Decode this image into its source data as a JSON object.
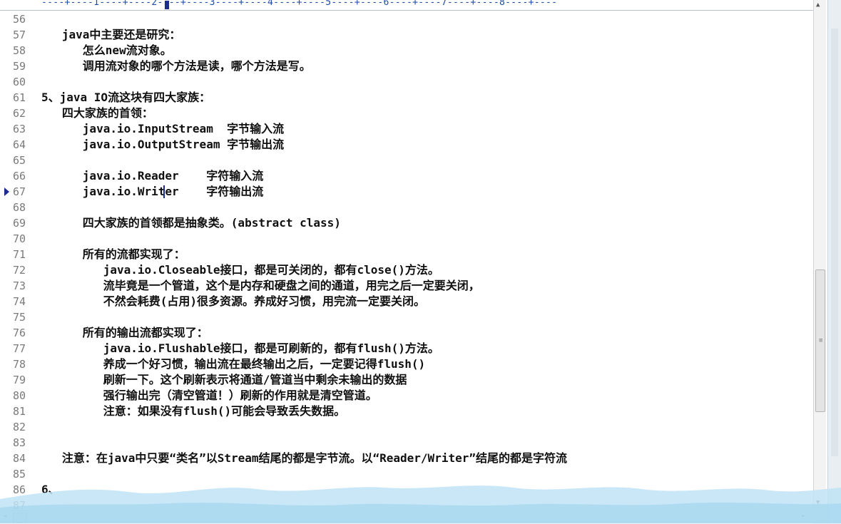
{
  "ruler": {
    "text": "----+----1----+----2----+----3----+----4----+----5----+----6----+----7----+----8----+----"
  },
  "lines": [
    {
      "num": "56",
      "text": ""
    },
    {
      "num": "57",
      "text": "   java中主要还是研究："
    },
    {
      "num": "58",
      "text": "      怎么new流对象。"
    },
    {
      "num": "59",
      "text": "      调用流对象的哪个方法是读，哪个方法是写。"
    },
    {
      "num": "60",
      "text": ""
    },
    {
      "num": "61",
      "text": "5、java IO流这块有四大家族："
    },
    {
      "num": "62",
      "text": "   四大家族的首领："
    },
    {
      "num": "63",
      "text": "      java.io.InputStream  字节输入流"
    },
    {
      "num": "64",
      "text": "      java.io.OutputStream 字节输出流"
    },
    {
      "num": "65",
      "text": ""
    },
    {
      "num": "66",
      "text": "      java.io.Reader    字符输入流"
    },
    {
      "num": "67",
      "text": "      java.io.Writer    字符输出流"
    },
    {
      "num": "68",
      "text": ""
    },
    {
      "num": "69",
      "text": "      四大家族的首领都是抽象类。(abstract class)"
    },
    {
      "num": "70",
      "text": ""
    },
    {
      "num": "71",
      "text": "      所有的流都实现了："
    },
    {
      "num": "72",
      "text": "         java.io.Closeable接口，都是可关闭的，都有close()方法。"
    },
    {
      "num": "73",
      "text": "         流毕竟是一个管道，这个是内存和硬盘之间的通道，用完之后一定要关闭，"
    },
    {
      "num": "74",
      "text": "         不然会耗费(占用)很多资源。养成好习惯，用完流一定要关闭。"
    },
    {
      "num": "75",
      "text": ""
    },
    {
      "num": "76",
      "text": "      所有的输出流都实现了："
    },
    {
      "num": "77",
      "text": "         java.io.Flushable接口，都是可刷新的，都有flush()方法。"
    },
    {
      "num": "78",
      "text": "         养成一个好习惯，输出流在最终输出之后，一定要记得flush()"
    },
    {
      "num": "79",
      "text": "         刷新一下。这个刷新表示将通道/管道当中剩余未输出的数据"
    },
    {
      "num": "80",
      "text": "         强行输出完（清空管道！）刷新的作用就是清空管道。"
    },
    {
      "num": "81",
      "text": "         注意：如果没有flush()可能会导致丢失数据。"
    },
    {
      "num": "82",
      "text": ""
    },
    {
      "num": "83",
      "text": ""
    },
    {
      "num": "84",
      "text": "   注意：在java中只要“类名”以Stream结尾的都是字节流。以“Reader/Writer”结尾的都是字符流"
    },
    {
      "num": "85",
      "text": ""
    },
    {
      "num": "86",
      "text": "6、"
    },
    {
      "num": "87",
      "text": ""
    }
  ],
  "current_line": "67",
  "icons": {
    "marker": "current-line-marker-icon",
    "grip": "scrollbar-grip-icon"
  },
  "colors": {
    "ruler": "#1f4fa8",
    "linenum": "#7a7a7a",
    "text": "#101010",
    "marker": "#1a2c8c"
  }
}
